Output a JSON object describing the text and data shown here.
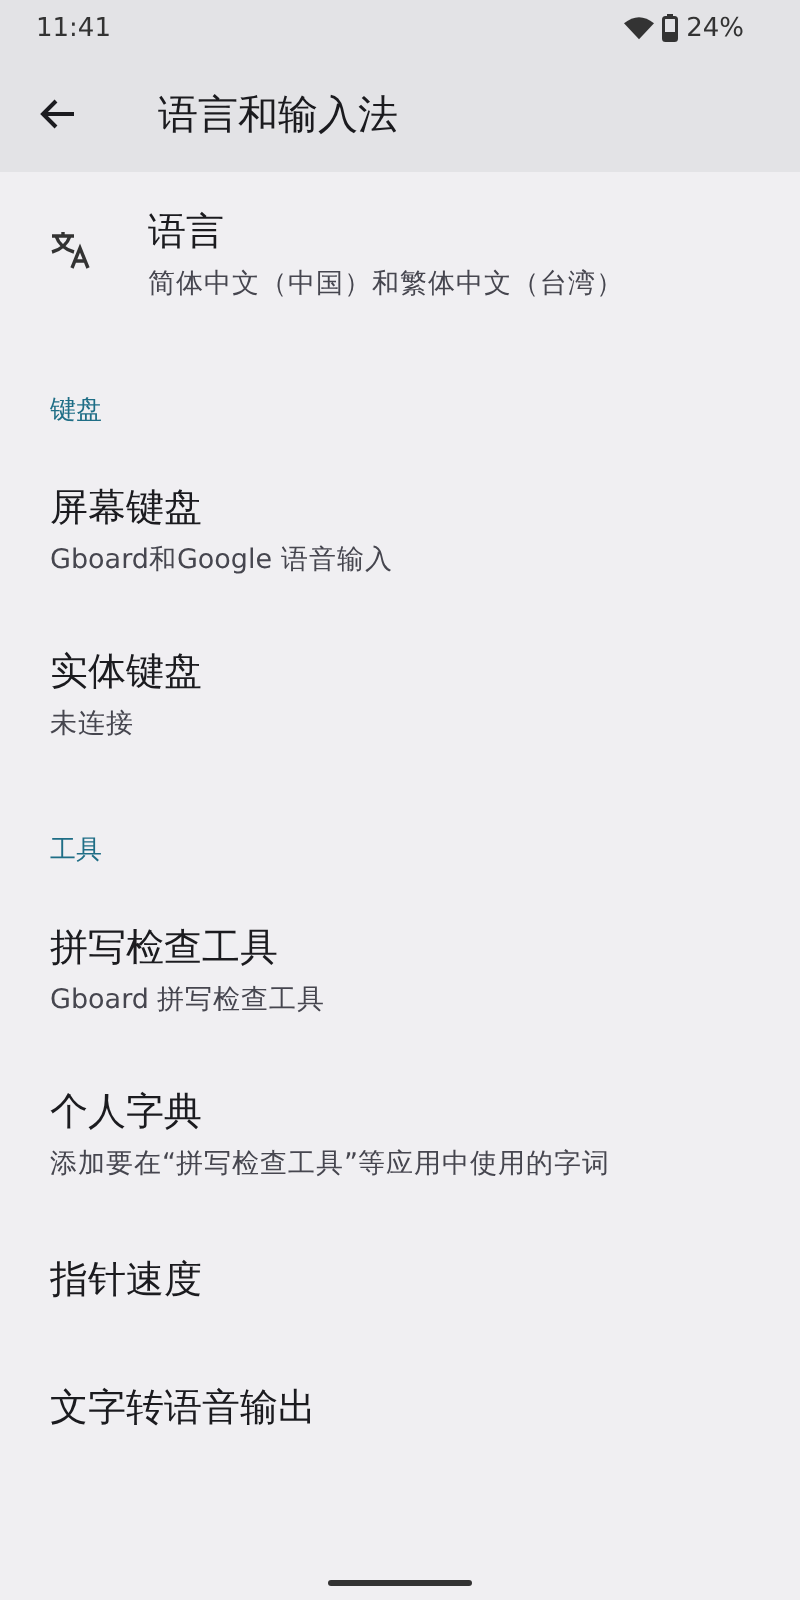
{
  "status_bar": {
    "time": "11:41",
    "battery": "24%"
  },
  "toolbar": {
    "title": "语言和输入法"
  },
  "sections": [
    {
      "items": [
        {
          "kind": "icon",
          "title": "语言",
          "subtitle": "简体中文（中国）和繁体中文（台湾）"
        }
      ]
    },
    {
      "header": "键盘",
      "items": [
        {
          "kind": "text",
          "title": "屏幕键盘",
          "subtitle": "Gboard和Google 语音输入"
        },
        {
          "kind": "text",
          "title": "实体键盘",
          "subtitle": "未连接"
        }
      ]
    },
    {
      "header": "工具",
      "items": [
        {
          "kind": "text",
          "title": "拼写检查工具",
          "subtitle": "Gboard 拼写检查工具"
        },
        {
          "kind": "text",
          "title": "个人字典",
          "subtitle": "添加要在“拼写检查工具”等应用中使用的字词"
        },
        {
          "kind": "text",
          "title": "指针速度"
        },
        {
          "kind": "text",
          "title": "文字转语音输出"
        }
      ]
    }
  ]
}
